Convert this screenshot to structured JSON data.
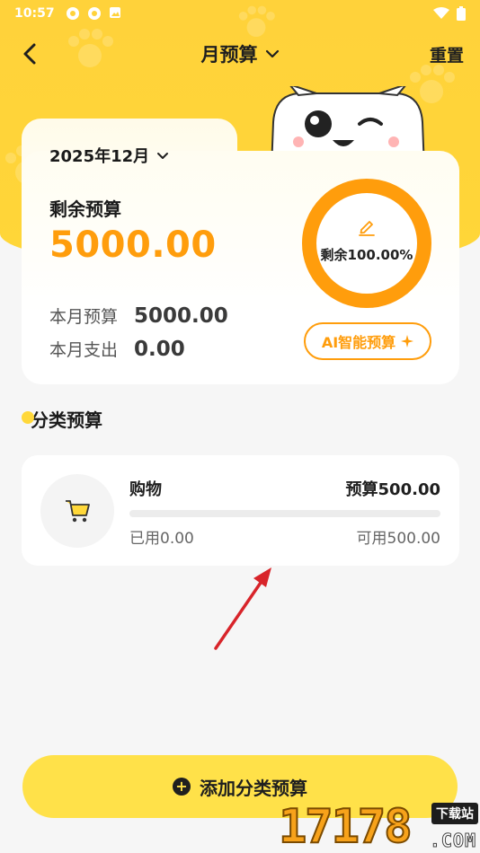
{
  "status_bar": {
    "time": "10:57",
    "icons": [
      "app-icon-1",
      "app-icon-2",
      "image-icon"
    ],
    "right_icons": [
      "wifi-icon",
      "battery-icon"
    ]
  },
  "nav": {
    "title": "月预算",
    "reset_label": "重置"
  },
  "summary": {
    "month": "2025年12月",
    "remain_label": "剩余预算",
    "remain_amount": "5000.00",
    "month_budget_label": "本月预算",
    "month_budget_value": "5000.00",
    "month_expense_label": "本月支出",
    "month_expense_value": "0.00",
    "ring_text": "剩余100.00%",
    "remain_fraction": 1.0,
    "ai_button_label": "AI智能预算"
  },
  "category_section": {
    "title": "分类预算",
    "items": [
      {
        "name": "购物",
        "budget": "预算500.00",
        "used": "已用0.00",
        "available": "可用500.00",
        "used_fraction": 0.0,
        "icon": "cart-icon"
      }
    ]
  },
  "add_button": {
    "label": "添加分类预算"
  },
  "watermark": {
    "digits": "17178",
    "tag": "下载站",
    "domain": ".COM"
  },
  "colors": {
    "accent_orange": "#ff9d0c",
    "header_yellow": "#ffd23a",
    "button_yellow": "#ffe149"
  }
}
